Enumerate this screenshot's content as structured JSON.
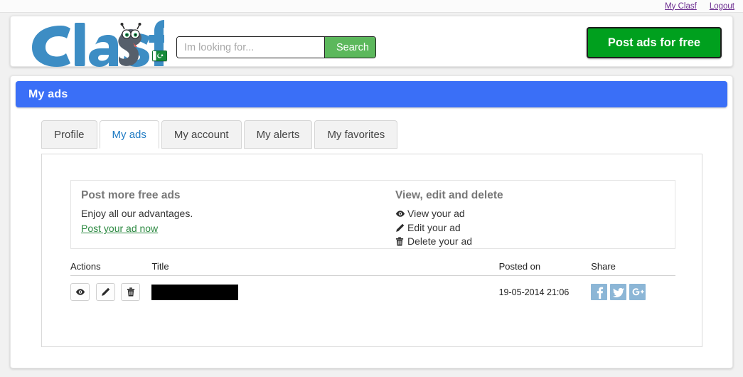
{
  "topbar": {
    "links": [
      {
        "label": "My Clasf",
        "name": "my-clasf-link"
      },
      {
        "label": "Logout",
        "name": "logout-link"
      }
    ]
  },
  "header": {
    "logo_text": "Clasf",
    "logo_alt": "clasf-logo",
    "flag_name": "pakistan-flag-icon",
    "search": {
      "placeholder": "Im looking for...",
      "value": "",
      "button_label": "Search"
    },
    "post_button_label": "Post ads for free"
  },
  "page": {
    "title": "My ads"
  },
  "tabs": [
    {
      "label": "Profile",
      "active": false
    },
    {
      "label": "My ads",
      "active": true
    },
    {
      "label": "My account",
      "active": false
    },
    {
      "label": "My alerts",
      "active": false
    },
    {
      "label": "My favorites",
      "active": false
    }
  ],
  "info": {
    "left": {
      "heading": "Post more free ads",
      "text": "Enjoy all our advantages.",
      "link": "Post your ad now"
    },
    "right": {
      "heading": "View, edit and delete",
      "items": [
        {
          "icon": "eye-icon",
          "label": "View your ad"
        },
        {
          "icon": "pencil-icon",
          "label": "Edit your ad"
        },
        {
          "icon": "trash-icon",
          "label": "Delete your ad"
        }
      ]
    }
  },
  "table": {
    "headers": {
      "actions": "Actions",
      "title": "Title",
      "posted_on": "Posted on",
      "share": "Share"
    },
    "rows": [
      {
        "title": "",
        "title_redacted": true,
        "posted_on": "19-05-2014 21:06",
        "actions": [
          "view",
          "edit",
          "delete"
        ],
        "share": [
          "facebook",
          "twitter",
          "googleplus"
        ]
      }
    ]
  },
  "colors": {
    "accent_blue": "#3a6ff7",
    "logo_blue": "#3d8dc4",
    "green_button": "#00a01e",
    "search_green": "#5cb85c",
    "link_green": "#2d8a42",
    "tab_active_text": "#1f7bc4",
    "share_blue": "#8cb6d6",
    "visited_link": "#6b2c8f"
  }
}
